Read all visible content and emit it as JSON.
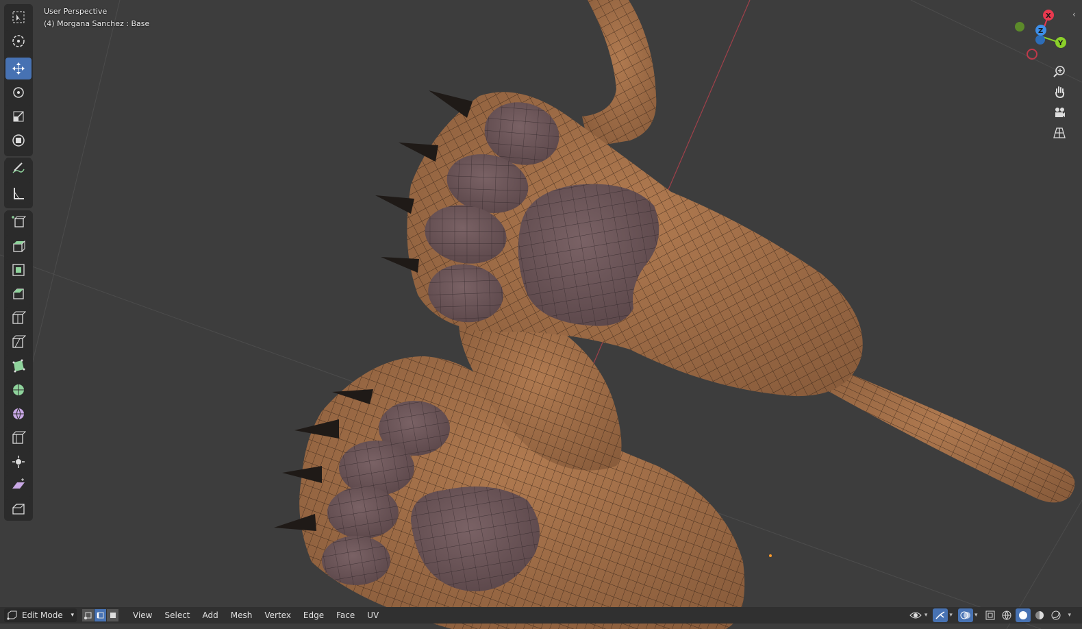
{
  "viewport": {
    "view_name": "User Perspective",
    "object_info": "(4) Morgana Sanchez : Base"
  },
  "toolbar": {
    "tools": [
      "select-box",
      "cursor",
      "move",
      "rotate",
      "scale",
      "transform",
      "annotate",
      "measure",
      "add-cube",
      "extrude",
      "inset",
      "bevel",
      "loop-cut",
      "knife",
      "poly-build",
      "spin",
      "smooth",
      "edge-slide",
      "shrink-fatten",
      "shear",
      "rip"
    ],
    "active_tool": "move"
  },
  "navigation_gizmo": {
    "axis_x": "X",
    "axis_y": "Y",
    "axis_z": "Z",
    "colors": {
      "x": "#e8394f",
      "y": "#8bd02a",
      "z": "#3d8ee8"
    }
  },
  "nav_buttons": [
    "zoom-icon",
    "pan-hand-icon",
    "camera-icon",
    "grid-perspective-icon"
  ],
  "header": {
    "mode": "Edit Mode",
    "menus": [
      "View",
      "Select",
      "Add",
      "Mesh",
      "Vertex",
      "Edge",
      "Face",
      "UV"
    ]
  },
  "colors": {
    "background": "#3d3d3d",
    "skin": "#a0704a",
    "pad": "#6b5558",
    "wire": "#2a1c12",
    "accent": "#4772b3"
  }
}
